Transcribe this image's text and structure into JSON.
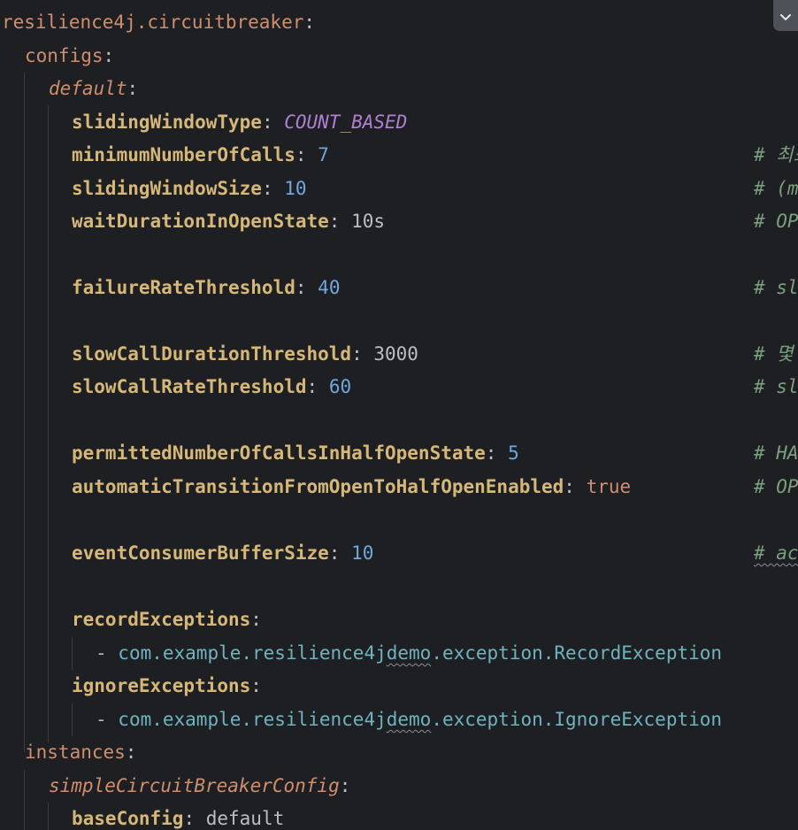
{
  "editor": {
    "lines": [
      {
        "key": "resilience4j.circuitbreaker"
      },
      {
        "key": "configs"
      },
      {
        "key": "default"
      },
      {
        "key": "slidingWindowType",
        "value": "COUNT_BASED"
      },
      {
        "key": "minimumNumberOfCalls",
        "value": "7",
        "comment": "# 최소"
      },
      {
        "key": "slidingWindowSize",
        "value": "10",
        "comment": "# (m"
      },
      {
        "key": "waitDurationInOpenState",
        "value": "10s",
        "comment": "# OP"
      },
      {
        "key": "failureRateThreshold",
        "value": "40",
        "comment": "# sl"
      },
      {
        "key": "slowCallDurationThreshold",
        "value": "3000",
        "comment": "# 몇"
      },
      {
        "key": "slowCallRateThreshold",
        "value": "60",
        "comment": "# sl"
      },
      {
        "key": "permittedNumberOfCallsInHalfOpenState",
        "value": "5",
        "comment": "# HA"
      },
      {
        "key": "automaticTransitionFromOpenToHalfOpenEnabled",
        "value": "true",
        "comment": "# OP"
      },
      {
        "key": "eventConsumerBufferSize",
        "value": "10",
        "comment": "# ac"
      },
      {
        "key": "recordExceptions"
      },
      {
        "value_pre": "com.example.resilience4j",
        "value_squiggle": "demo",
        "value_post": ".exception.RecordException"
      },
      {
        "key": "ignoreExceptions"
      },
      {
        "value_pre": "com.example.resilience4j",
        "value_squiggle": "demo",
        "value_post": ".exception.IgnoreException"
      },
      {
        "key": "instances"
      },
      {
        "key": "simpleCircuitBreakerConfig"
      },
      {
        "key": "baseConfig",
        "value": "default"
      }
    ]
  },
  "icons": {
    "collapse": "chevron-down-icon"
  }
}
